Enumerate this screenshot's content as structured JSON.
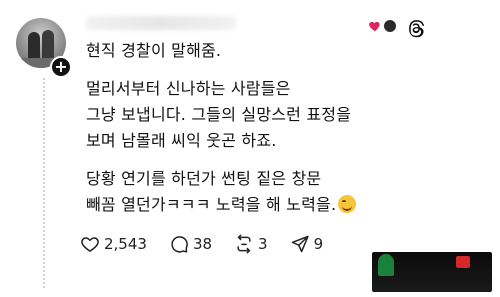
{
  "post": {
    "username": "",
    "lines_block1": [
      "현직 경찰이 말해줌."
    ],
    "lines_block2": [
      "멀리서부터 신나하는 사람들은",
      "그냥 보냅니다. 그들의 실망스런 표정을",
      "보며 남몰래 씨익 웃곤 하죠."
    ],
    "lines_block3": [
      "당황 연기를 하던가 썬팅 짙은 창문",
      "빼꼼 열던가ㅋㅋㅋ 노력을 해 노력을."
    ],
    "emoji_icon": "grinning-squinting-face"
  },
  "actions": {
    "likes": "2,543",
    "replies": "38",
    "reposts": "3",
    "shares": "9"
  },
  "watermark": {
    "line1": "",
    "line2": ""
  },
  "colors": {
    "text": "#111111",
    "muted": "#222222",
    "heart": "#e0245e"
  }
}
